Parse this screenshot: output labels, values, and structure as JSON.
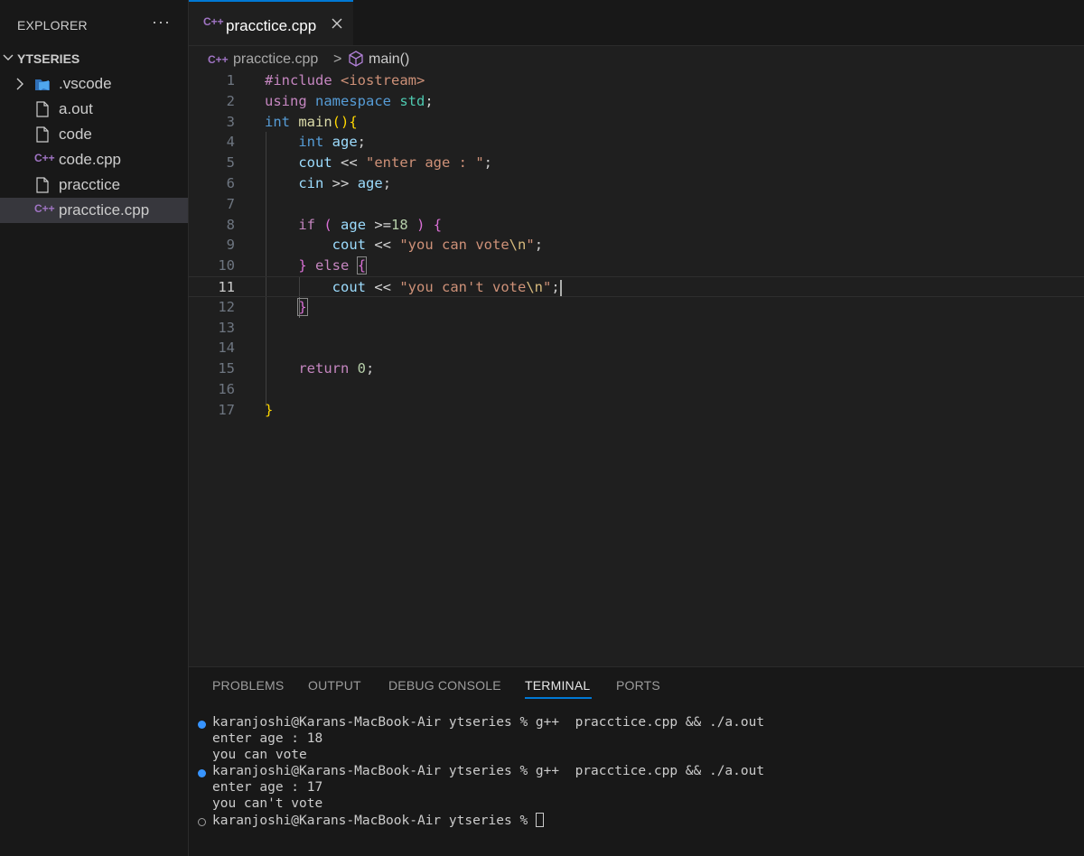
{
  "sidebar": {
    "title": "EXPLORER",
    "more": "···",
    "folder": "YTSERIES",
    "items": [
      {
        "label": ".vscode",
        "icon": "vscode-folder-icon"
      },
      {
        "label": "a.out",
        "icon": "file-icon"
      },
      {
        "label": "code",
        "icon": "file-icon"
      },
      {
        "label": "code.cpp",
        "icon": "cpp-file-icon"
      },
      {
        "label": "pracctice",
        "icon": "file-icon"
      },
      {
        "label": "pracctice.cpp",
        "icon": "cpp-file-icon",
        "selected": true
      }
    ]
  },
  "editor": {
    "tab_label": "pracctice.cpp",
    "cpp_icon_text": "C++",
    "breadcrumb": {
      "file": "pracctice.cpp",
      "sep": ">",
      "symbol": "main()"
    },
    "current_line": 11,
    "line_numbers": [
      "1",
      "2",
      "3",
      "4",
      "5",
      "6",
      "7",
      "8",
      "9",
      "10",
      "11",
      "12",
      "13",
      "14",
      "15",
      "16",
      "17"
    ]
  },
  "panel": {
    "tabs": [
      "PROBLEMS",
      "OUTPUT",
      "DEBUG CONSOLE",
      "TERMINAL",
      "PORTS"
    ],
    "active_tab": "TERMINAL",
    "terminal_lines": [
      "karanjoshi@Karans-MacBook-Air ytseries % g++  pracctice.cpp && ./a.out",
      "enter age : 18",
      "you can vote",
      "karanjoshi@Karans-MacBook-Air ytseries % g++  pracctice.cpp && ./a.out",
      "enter age : 17",
      "you can't vote",
      "karanjoshi@Karans-MacBook-Air ytseries % "
    ]
  },
  "colors": {
    "accent": "#0078d4",
    "cpp_icon": "#a074c4",
    "terminal_dot": "#3794ff"
  }
}
